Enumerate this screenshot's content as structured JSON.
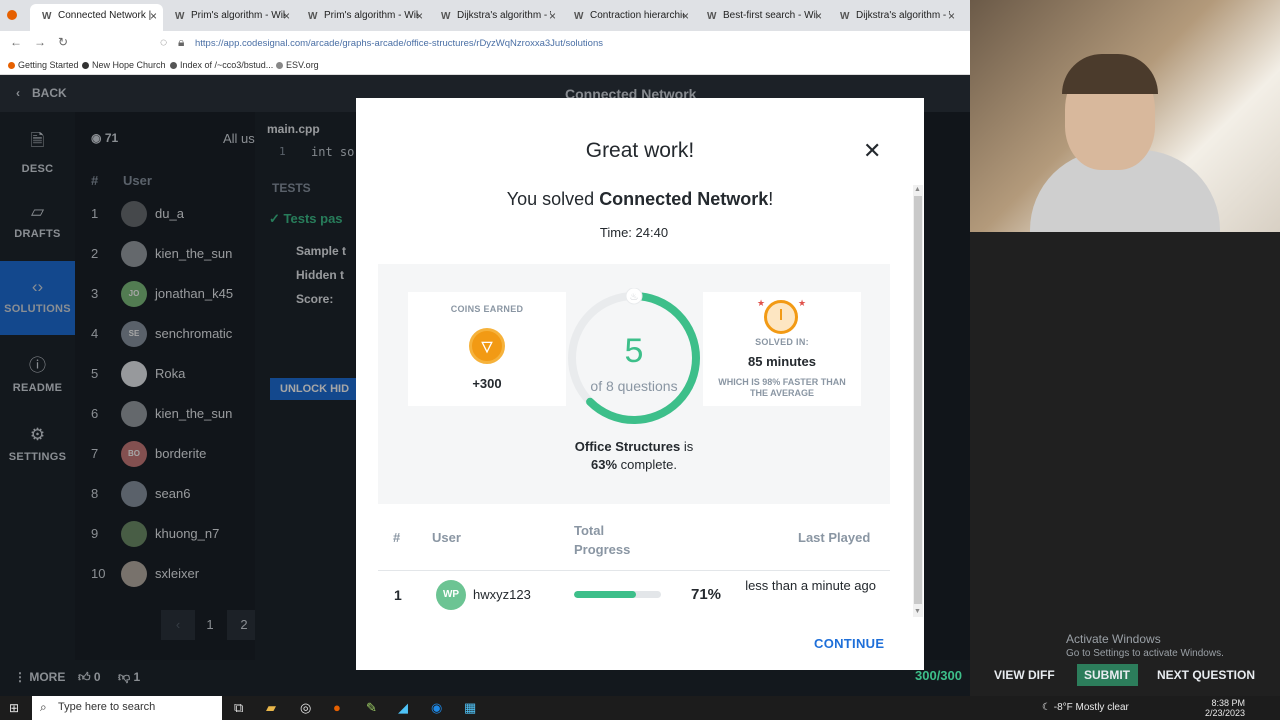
{
  "browser": {
    "tabs": [
      {
        "label": "Connected Network | Code",
        "active": true
      },
      {
        "label": "Prim's algorithm - Wikiped"
      },
      {
        "label": "Prim's algorithm - Wikiped"
      },
      {
        "label": "Dijkstra's algorithm - Wikip"
      },
      {
        "label": "Contraction hierarchies - W"
      },
      {
        "label": "Best-first search - Wikipedia"
      },
      {
        "label": "Dijkstra's algorithm - Wikip"
      }
    ],
    "url": "https://app.codesignal.com/arcade/graphs-arcade/office-structures/rDyzWqNzroxxa3Jut/solutions",
    "bookmarks": [
      "Getting Started",
      "New Hope Church",
      "Index of /~cco3/bstud...",
      "ESV.org"
    ]
  },
  "app": {
    "back_label": "BACK",
    "problem_title": "Connected Network",
    "sidebar": [
      {
        "label": "DESC",
        "icon": "document-icon"
      },
      {
        "label": "DRAFTS",
        "icon": "drafts-icon"
      },
      {
        "label": "SOLUTIONS",
        "icon": "code-icon"
      },
      {
        "label": "README",
        "icon": "info-icon"
      },
      {
        "label": "SETTINGS",
        "icon": "gear-icon"
      }
    ],
    "leaderboard": {
      "count": "71",
      "filter": "All us",
      "col_num": "#",
      "col_user": "User",
      "rows": [
        {
          "rank": "1",
          "user": "du_a"
        },
        {
          "rank": "2",
          "user": "kien_the_sun"
        },
        {
          "rank": "3",
          "user": "jonathan_k45",
          "initials": "JO"
        },
        {
          "rank": "4",
          "user": "senchromatic",
          "initials": "SE"
        },
        {
          "rank": "5",
          "user": "Roka"
        },
        {
          "rank": "6",
          "user": "kien_the_sun"
        },
        {
          "rank": "7",
          "user": "borderite",
          "initials": "BO"
        },
        {
          "rank": "8",
          "user": "sean6"
        },
        {
          "rank": "9",
          "user": "khuong_n7"
        },
        {
          "rank": "10",
          "user": "sxleixer"
        }
      ],
      "pages": [
        "‹",
        "1",
        "2"
      ]
    },
    "editor": {
      "file_tab": "main.cpp",
      "line_no": "1",
      "code": "int so",
      "tests_tab": "TESTS",
      "tests_status": "Tests pas",
      "sample": "Sample t",
      "hidden": "Hidden t",
      "score": "Score:",
      "unlock": "UNLOCK HID"
    },
    "bottom": {
      "more": "MORE",
      "likes": "0",
      "dislikes": "1",
      "score": "300/300",
      "view_diff": "VIEW DIFF",
      "submit": "SUBMIT",
      "next": "NEXT QUESTION"
    }
  },
  "modal": {
    "title": "Great work!",
    "solved_prefix": "You solved ",
    "solved_name": "Connected Network",
    "solved_suffix": "!",
    "time": "Time: 24:40",
    "coins_caption": "COINS EARNED",
    "coins_value": "+300",
    "progress_done": "5",
    "progress_total_label": "of 8 questions",
    "progress_fraction": 0.625,
    "solved_in_caption": "SOLVED IN:",
    "solved_in_value": "85 minutes",
    "faster_text": "WHICH IS 98% FASTER THAN THE AVERAGE",
    "complete_name": "Office Structures",
    "complete_mid": " is ",
    "complete_pct": "63%",
    "complete_suffix": " complete.",
    "table_headers": {
      "num": "#",
      "user": "User",
      "progress": "Total Progress",
      "last": "Last Played"
    },
    "row": {
      "rank": "1",
      "initials": "WP",
      "user": "hwxyz123",
      "progress_fraction": 0.71,
      "pct": "71%",
      "last": "less than a minute ago"
    },
    "continue": "CONTINUE",
    "close_icon": "close-icon"
  },
  "desktop": {
    "activate_title": "Activate Windows",
    "activate_sub": "Go to Settings to activate Windows."
  },
  "taskbar": {
    "search_placeholder": "Type here to search",
    "weather": "-8°F  Mostly clear",
    "time": "8:38 PM",
    "date": "2/23/2023"
  },
  "colors": {
    "accent": "#1e6fd9",
    "success": "#3dbf8a",
    "coin": "#f29a14"
  }
}
